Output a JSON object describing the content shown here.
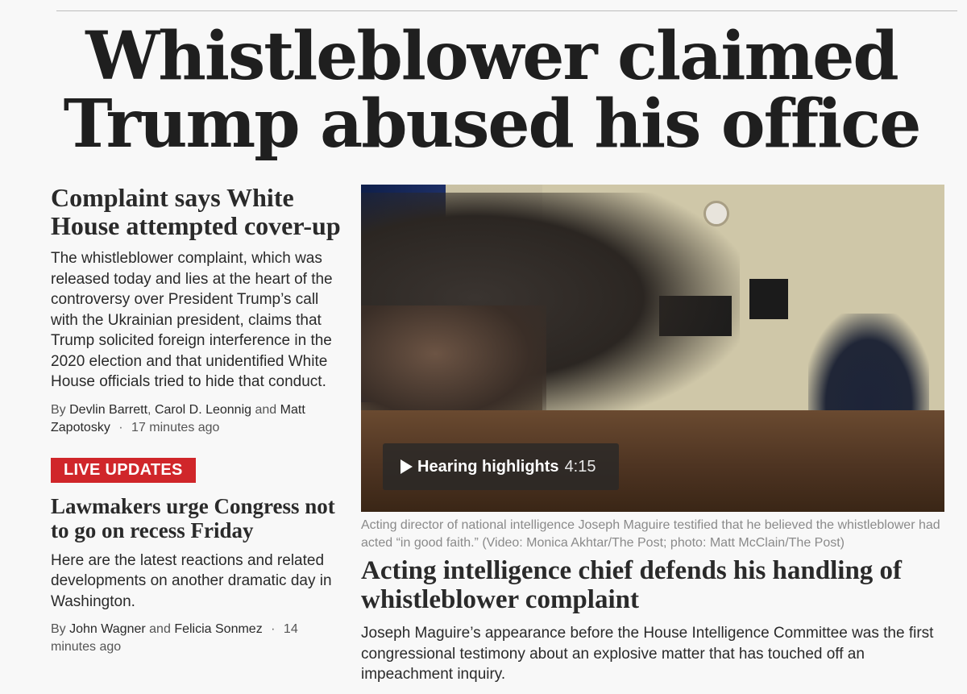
{
  "main_headline": "Whistleblower claimed Trump abused his office",
  "story1": {
    "headline": "Complaint says White House attempted cover-up",
    "blurb": "The whistleblower complaint, which was released today and lies at the heart of the controversy over President Trump’s call with the Ukrainian president, claims that Trump solicited foreign interference in the 2020 election and that unidentified White House officials tried to hide that conduct.",
    "byline_prefix": "By",
    "authors": [
      "Devlin Barrett",
      "Carol D. Leonnig",
      "Matt Zapotosky"
    ],
    "separator": ",",
    "conjunction": "and",
    "timestamp": "17 minutes ago"
  },
  "live_badge": "LIVE UPDATES",
  "story2": {
    "headline": "Lawmakers urge Congress not to go on recess Friday",
    "blurb": "Here are the latest reactions and related developments on another dramatic day in Washington.",
    "byline_prefix": "By",
    "authors": [
      "John Wagner",
      "Felicia Sonmez"
    ],
    "conjunction": "and",
    "timestamp": "14 minutes ago"
  },
  "video": {
    "label": "Hearing highlights",
    "duration": "4:15"
  },
  "caption": "Acting director of national intelligence Joseph Maguire testified that he believed the whistleblower had acted “in good faith.” (Video: Monica Akhtar/The Post; photo: Matt McClain/The Post)",
  "story3": {
    "headline": "Acting intelligence chief defends his handling of whistleblower complaint",
    "blurb": "Joseph Maguire’s appearance before the House Intelligence Committee was the first congressional testimony about an explosive matter that has touched off an impeachment inquiry."
  },
  "colors": {
    "live_badge": "#d0262a",
    "text": "#2a2a2a",
    "caption": "#8a8a8a"
  }
}
